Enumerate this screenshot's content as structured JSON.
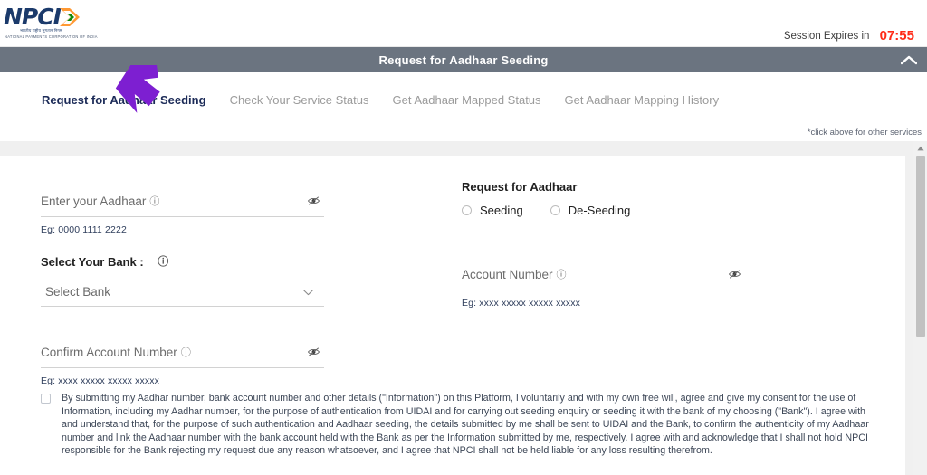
{
  "header": {
    "logo": {
      "wordmark": "NPCI",
      "hindi_line": "भारतीय राष्ट्रीय भुगतान निगम",
      "subtitle": "NATIONAL PAYMENTS CORPORATION OF INDIA",
      "brand_color": "#1b3a6b",
      "arrow_colors": [
        "#ff9933",
        "#ffffff",
        "#138808"
      ]
    },
    "session_label": "Session Expires in",
    "session_timer": "07:55",
    "session_timer_color": "#ff2b17"
  },
  "titlebar": {
    "title": "Request for Aadhaar Seeding",
    "background": "#6b7480",
    "collapse_icon": "chevron-up-icon"
  },
  "tabs": [
    {
      "label": "Request for Aadhaar Seeding",
      "active": true
    },
    {
      "label": "Check Your Service Status",
      "active": false
    },
    {
      "label": "Get Aadhaar Mapped Status",
      "active": false
    },
    {
      "label": "Get Aadhaar Mapping History",
      "active": false
    }
  ],
  "note": "*click above for other services",
  "form": {
    "aadhaar": {
      "label": "Enter your Aadhaar",
      "value": "",
      "placeholder": "Enter your Aadhaar",
      "helper": "Eg: 0000 1111 2222",
      "info_icon": "info-icon",
      "toggle_icon": "eye-slash-icon"
    },
    "bank": {
      "label": "Select Your Bank :",
      "info_icon": "info-icon",
      "selected": "Select Bank",
      "chevron_icon": "chevron-down-icon"
    },
    "confirm_account": {
      "label": "Confirm Account Number",
      "value": "",
      "placeholder": "Confirm Account Number",
      "helper": "Eg: xxxx xxxxx xxxxx xxxxx",
      "info_icon": "info-icon",
      "toggle_icon": "eye-slash-icon"
    },
    "request_type": {
      "title": "Request for Aadhaar",
      "options": [
        {
          "label": "Seeding",
          "selected": false
        },
        {
          "label": "De-Seeding",
          "selected": false
        }
      ]
    },
    "account_number": {
      "label": "Account Number",
      "value": "",
      "placeholder": "Account Number",
      "helper": "Eg: xxxx xxxxx xxxxx xxxxx",
      "info_icon": "info-icon",
      "toggle_icon": "eye-slash-icon"
    },
    "consent": {
      "checked": false,
      "text": "By submitting my Aadhar number, bank account number and other details (\"Information\") on this Platform, I voluntarily and with my own free will, agree and give my consent for the use of Information, including my Aadhar number, for the purpose of authentication from UIDAI and for carrying out seeding enquiry or seeding it with the bank of my choosing (\"Bank\"). I agree with and understand that, for the purpose of such authentication and Aadhaar seeding, the details submitted by me shall be sent to UIDAI and the Bank, to confirm the authenticity of my Aadhaar number and link the Aadhaar number with the bank account held with the Bank as per the Information submitted by me, respectively. I agree with and acknowledge that I shall not hold NPCI responsible for the Bank rejecting my request due any reason whatsoever, and I agree that NPCI shall not be held liable for any loss resulting therefrom."
    }
  },
  "scrollbar": {
    "up_icon": "scroll-up-arrow-icon",
    "thumb_color": "#c1c1c1"
  },
  "cursor": {
    "icon": "mouse-pointer-arrow",
    "color": "#7d1fd1"
  }
}
